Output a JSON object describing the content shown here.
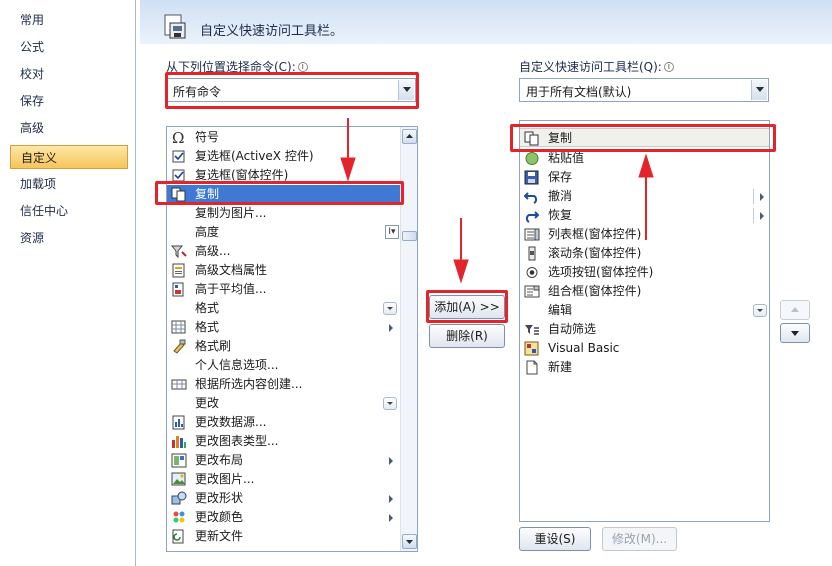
{
  "nav": {
    "items": [
      "常用",
      "公式",
      "校对",
      "保存",
      "高级",
      "自定义",
      "加载项",
      "信任中心",
      "资源"
    ],
    "active_index": 5
  },
  "header": {
    "title": "自定义快速访问工具栏。"
  },
  "left": {
    "label": "从下列位置选择命令(C):",
    "dropdown_value": "所有命令",
    "commands": [
      {
        "label": "符号",
        "icon": "omega-icon"
      },
      {
        "label": "复选框(ActiveX 控件)",
        "icon": "checkbox-icon"
      },
      {
        "label": "复选框(窗体控件)",
        "icon": "checkbox-icon"
      },
      {
        "label": "复制",
        "icon": "copy-icon"
      },
      {
        "label": "复制为图片...",
        "icon": ""
      },
      {
        "label": "高度",
        "icon": ""
      },
      {
        "label": "高级...",
        "icon": "filter-advanced-icon"
      },
      {
        "label": "高级文档属性",
        "icon": "document-properties-icon"
      },
      {
        "label": "高于平均值...",
        "icon": "above-average-icon"
      },
      {
        "label": "格式",
        "icon": ""
      },
      {
        "label": "格式",
        "icon": "format-cells-icon"
      },
      {
        "label": "格式刷",
        "icon": "format-painter-icon"
      },
      {
        "label": "个人信息选项...",
        "icon": ""
      },
      {
        "label": "根据所选内容创建...",
        "icon": "create-from-selection-icon"
      },
      {
        "label": "更改",
        "icon": ""
      },
      {
        "label": "更改数据源...",
        "icon": "change-data-source-icon"
      },
      {
        "label": "更改图表类型...",
        "icon": "chart-type-icon"
      },
      {
        "label": "更改布局",
        "icon": "layout-icon"
      },
      {
        "label": "更改图片...",
        "icon": "change-picture-icon"
      },
      {
        "label": "更改形状",
        "icon": "shape-icon"
      },
      {
        "label": "更改颜色",
        "icon": "colors-icon"
      },
      {
        "label": "更新文件",
        "icon": "update-file-icon"
      }
    ]
  },
  "right": {
    "label": "自定义快速访问工具栏(Q):",
    "dropdown_value": "用于所有文档(默认)",
    "items": [
      {
        "label": "复制",
        "icon": "copy-icon"
      },
      {
        "label": "粘贴值",
        "icon": "paste-values-icon"
      },
      {
        "label": "保存",
        "icon": "save-icon"
      },
      {
        "label": "撤消",
        "icon": "undo-icon"
      },
      {
        "label": "恢复",
        "icon": "redo-icon"
      },
      {
        "label": "列表框(窗体控件)",
        "icon": "listbox-icon"
      },
      {
        "label": "滚动条(窗体控件)",
        "icon": "scrollbar-icon"
      },
      {
        "label": "选项按钮(窗体控件)",
        "icon": "radio-icon"
      },
      {
        "label": "组合框(窗体控件)",
        "icon": "combobox-icon"
      },
      {
        "label": "编辑",
        "icon": ""
      },
      {
        "label": "自动筛选",
        "icon": "autofilter-icon"
      },
      {
        "label": "Visual Basic",
        "icon": "visual-basic-icon"
      },
      {
        "label": "新建",
        "icon": "new-document-icon"
      }
    ]
  },
  "buttons": {
    "add": "添加(A) >>",
    "remove": "删除(R)",
    "reset": "重设(S)",
    "modify": "修改(M)..."
  },
  "colors": {
    "selection": "#3f79d3",
    "annotation_red": "#e3242b",
    "active_nav": "#f7c55a"
  }
}
